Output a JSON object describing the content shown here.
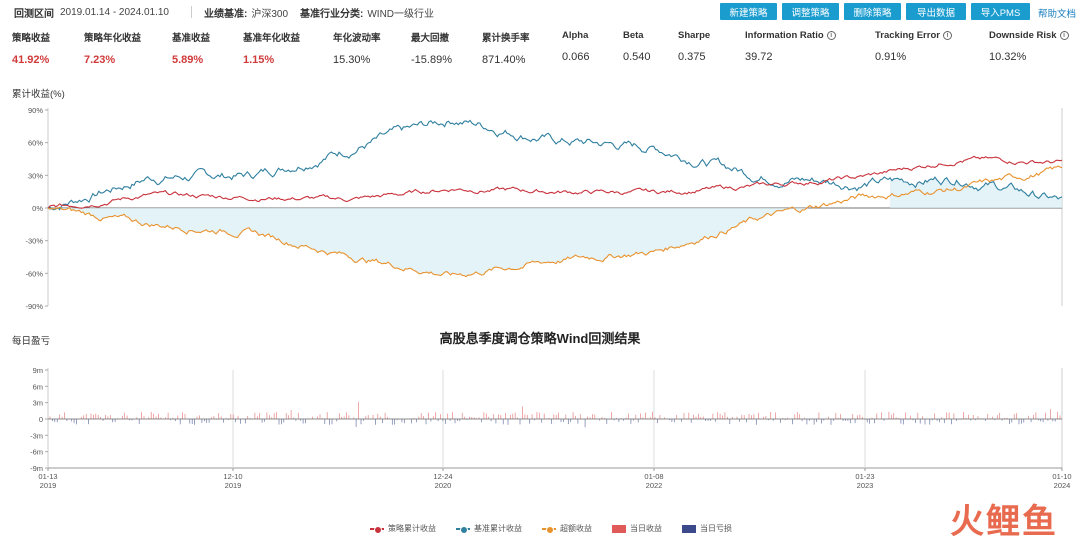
{
  "header": {
    "period_label": "回测区间",
    "period_value": "2019.01.14 - 2024.01.10",
    "benchmark_label": "业绩基准:",
    "benchmark_value": "沪深300",
    "industry_label": "基准行业分类:",
    "industry_value": "WIND一级行业",
    "buttons": [
      "新建策略",
      "调整策略",
      "删除策略",
      "导出数据",
      "导入PMS"
    ],
    "help": "帮助文档"
  },
  "metrics": [
    {
      "label": "策略收益",
      "value": "41.92%",
      "red": true,
      "info": false
    },
    {
      "label": "策略年化收益",
      "value": "7.23%",
      "red": true,
      "info": false
    },
    {
      "label": "基准收益",
      "value": "5.89%",
      "red": true,
      "info": false
    },
    {
      "label": "基准年化收益",
      "value": "1.15%",
      "red": true,
      "info": false
    },
    {
      "label": "年化波动率",
      "value": "15.30%",
      "red": false,
      "info": false
    },
    {
      "label": "最大回撤",
      "value": "-15.89%",
      "red": false,
      "info": false
    },
    {
      "label": "累计换手率",
      "value": "871.40%",
      "red": false,
      "info": false
    },
    {
      "label": "Alpha",
      "value": "0.066",
      "red": false,
      "info": false
    },
    {
      "label": "Beta",
      "value": "0.540",
      "red": false,
      "info": false
    },
    {
      "label": "Sharpe",
      "value": "0.375",
      "red": false,
      "info": false
    },
    {
      "label": "Information Ratio",
      "value": "39.72",
      "red": false,
      "info": true
    },
    {
      "label": "Tracking Error",
      "value": "0.91%",
      "red": false,
      "info": true
    },
    {
      "label": "Downside Risk",
      "value": "10.32%",
      "red": false,
      "info": true
    }
  ],
  "info_icon": "i",
  "cum_label": "累计收益(%)",
  "daily_label": "每日盈亏",
  "chart_title": "高股息季度调仓策略Wind回测结果",
  "legend": [
    "策略累计收益",
    "基准累计收益",
    "超额收益",
    "当日收益",
    "当日亏损"
  ],
  "watermark": "火鲤鱼",
  "colors": {
    "strategy": "#c8323c",
    "benchmark": "#2f7f9f",
    "excess": "#e8922e",
    "gain": "#e05a5a",
    "loss": "#3c4a8c",
    "button": "#1a9ccf"
  },
  "chart_data": [
    {
      "type": "line",
      "title": "",
      "ylabel": "累计收益(%)",
      "y_ticks": [
        "90%",
        "60%",
        "30%",
        "0%",
        "-30%",
        "-60%",
        "-90%"
      ],
      "ylim": [
        -90,
        90
      ],
      "x": [
        "2019-01",
        "2019-06",
        "2019-12",
        "2020-06",
        "2020-12",
        "2021-06",
        "2021-12",
        "2022-06",
        "2022-12",
        "2023-06",
        "2024-01"
      ],
      "series": [
        {
          "name": "策略累计收益",
          "values": [
            0,
            12,
            10,
            8,
            18,
            15,
            14,
            20,
            28,
            45,
            42
          ]
        },
        {
          "name": "基准累计收益",
          "values": [
            0,
            28,
            30,
            55,
            82,
            62,
            55,
            30,
            22,
            28,
            6
          ]
        },
        {
          "name": "超额收益",
          "values": [
            0,
            -15,
            -22,
            -45,
            -62,
            -48,
            -40,
            -10,
            10,
            18,
            36
          ]
        }
      ]
    },
    {
      "type": "bar",
      "ylabel": "每日盈亏",
      "y_ticks": [
        "9m",
        "6m",
        "3m",
        "0",
        "-3m",
        "-6m",
        "-9m"
      ],
      "ylim": [
        -9,
        9
      ],
      "x_ticks": [
        {
          "date": "01-13",
          "year": "2019"
        },
        {
          "date": "12-10",
          "year": "2019"
        },
        {
          "date": "12-24",
          "year": "2020"
        },
        {
          "date": "01-08",
          "year": "2022"
        },
        {
          "date": "01-23",
          "year": "2023"
        },
        {
          "date": "01-10",
          "year": "2024"
        }
      ]
    }
  ]
}
